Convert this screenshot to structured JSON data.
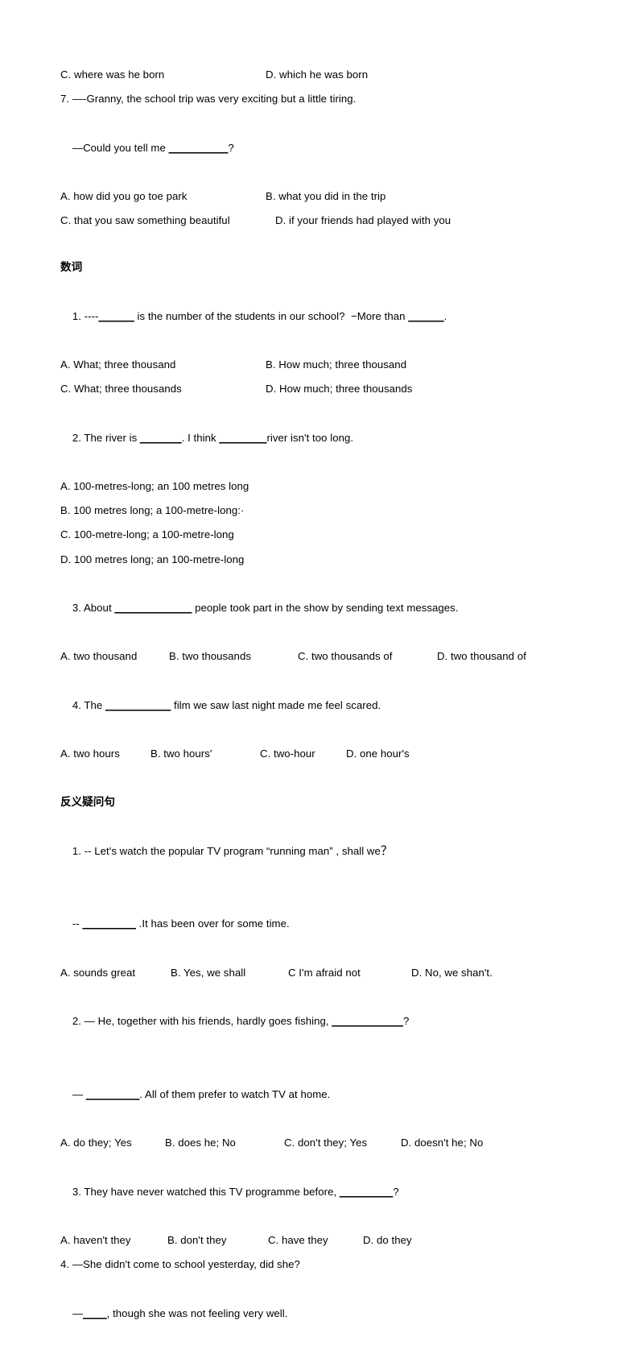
{
  "document": {
    "title": "English grammar exercise worksheet",
    "language": "zh-CN / en"
  },
  "top_block": {
    "continued_options": {
      "c": "C. where was he born",
      "d": "D. which he was born"
    },
    "question7": {
      "stem_line1": "7. —-Granny, the school trip was very exciting but a little tiring.",
      "stem_line2_pre": "—Could you tell me ",
      "stem_line2_blank": "__________",
      "stem_line2_post": "?",
      "options": {
        "a": "A. how did you go toe park",
        "b": "B. what you did in the trip",
        "c": "C. that you saw something beautiful",
        "d": "D. if your friends had played with you"
      }
    }
  },
  "section_numerals": {
    "heading": "数词",
    "questions": [
      {
        "stem_pre": "1. ----",
        "stem_blank1": "______",
        "stem_mid": " is the number of the students in our school?  −More than ",
        "stem_blank2": "______",
        "stem_post": ".",
        "options": {
          "a": "A. What; three thousand",
          "b": "B. How much; three thousand",
          "c": "C. What; three thousands",
          "d": "D. How much; three thousands"
        }
      },
      {
        "stem_pre": "2. The river is ",
        "stem_blank1": "_______",
        "stem_mid": ". I think ",
        "stem_blank2": "________",
        "stem_post": "river isn't too long.",
        "options": {
          "a": "A. 100-metres-long; an 100 metres long",
          "b": "B. 100 metres long; a 100-metre-long:·",
          "c": "C. 100-metre-long; a 100-metre-long",
          "d": "D. 100 metres long; an 100-metre-long"
        }
      },
      {
        "stem_pre": "3. About ",
        "stem_blank1": "_____________",
        "stem_post": " people took part in the show by sending text messages.",
        "options": {
          "a": "A. two thousand",
          "b": "B. two thousands",
          "c": "C. two thousands of",
          "d": "D. two thousand of"
        }
      },
      {
        "stem_pre": "4. The ",
        "stem_blank1": "___________",
        "stem_post": " film we saw last night made me feel scared.",
        "options": {
          "a": "A. two hours",
          "b": "B. two hours'",
          "c": "C. two-hour",
          "d": "D. one hour's"
        }
      }
    ]
  },
  "section_tag_questions": {
    "heading": "反义疑问句",
    "questions": [
      {
        "stem_line1_pre": "1. -- Let's watch the popular TV program “running man” , shall we",
        "stem_line1_q": "？",
        "stem_line2_pre": "-- ",
        "stem_line2_blank": "_________",
        "stem_line2_post": " .It has been over for some time.",
        "options": {
          "a": "A. sounds great",
          "b": "B. Yes, we shall",
          "c": "C I'm afraid not",
          "d": "D. No, we shan't."
        }
      },
      {
        "stem_line1_pre": "2. — He, together with his friends, hardly goes fishing, ",
        "stem_line1_blank": "____________",
        "stem_line1_post": "?",
        "stem_line2_pre": "— ",
        "stem_line2_blank": "_________",
        "stem_line2_post": ". All of them prefer to watch TV at home.",
        "options": {
          "a": "A. do they; Yes",
          "b": "B. does he; No",
          "c": "C. don't they; Yes",
          "d": "D. doesn't he; No"
        }
      },
      {
        "stem_line1_pre": "3. They have never watched this TV programme before, ",
        "stem_line1_blank": "_________",
        "stem_line1_post": "?",
        "options": {
          "a": "A. haven't they",
          "b": "B. don't they",
          "c": "C. have they",
          "d": "D. do they"
        }
      },
      {
        "stem_line1": "4. —She didn't come to school yesterday, did she?",
        "stem_line2_pre": "—",
        "stem_line2_blank": "____",
        "stem_line2_post": ", though she was not feeling very well."
      }
    ]
  }
}
